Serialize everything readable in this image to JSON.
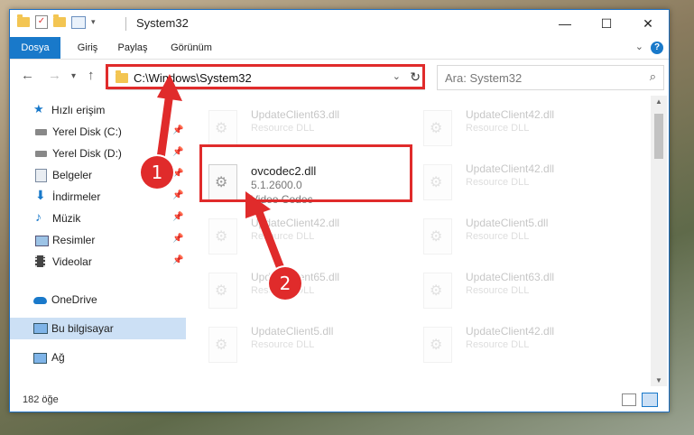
{
  "window": {
    "title": "System32",
    "minimize": "—",
    "maximize": "☐",
    "close": "✕"
  },
  "ribbon": {
    "tabs": [
      "Dosya",
      "Giriş",
      "Paylaş",
      "Görünüm"
    ],
    "help": "?",
    "expand": "⌄"
  },
  "nav": {
    "back": "←",
    "forward": "→",
    "recent": "▾",
    "up": "↑",
    "address": "C:\\Windows\\System32",
    "address_dropdown": "⌄",
    "refresh": "↻",
    "search_placeholder": "Ara: System32",
    "search_icon": "⌕"
  },
  "sidebar": {
    "items": [
      {
        "label": "Hızlı erişim",
        "icon": "star-icon",
        "pinned": false
      },
      {
        "label": "Yerel Disk (C:)",
        "icon": "drive-icon",
        "pinned": true
      },
      {
        "label": "Yerel Disk (D:)",
        "icon": "drive-icon",
        "pinned": true
      },
      {
        "label": "Belgeler",
        "icon": "documents-icon",
        "pinned": true
      },
      {
        "label": "İndirmeler",
        "icon": "downloads-icon",
        "pinned": true
      },
      {
        "label": "Müzik",
        "icon": "music-icon",
        "pinned": true
      },
      {
        "label": "Resimler",
        "icon": "pictures-icon",
        "pinned": true
      },
      {
        "label": "Videolar",
        "icon": "videos-icon",
        "pinned": true
      },
      {
        "label": "OneDrive",
        "icon": "onedrive-icon",
        "pinned": false
      },
      {
        "label": "Bu bilgisayar",
        "icon": "computer-icon",
        "pinned": false
      },
      {
        "label": "Ağ",
        "icon": "network-icon",
        "pinned": false
      }
    ],
    "pin_glyph": "📌"
  },
  "files": {
    "left": [
      {
        "name": "UpdateClient63.dll",
        "type": "Resource DLL"
      },
      {
        "name": "UpdateClient42.dll",
        "type": "Resource DLL"
      },
      {
        "name": "UpdateClient65.dll",
        "type": "Resource DLL"
      },
      {
        "name": "UpdateClient5.dll",
        "type": "Resource DLL"
      }
    ],
    "right": [
      {
        "name": "UpdateClient42.dll",
        "type": "Resource DLL"
      },
      {
        "name": "UpdateClient42.dll",
        "type": "Resource DLL"
      },
      {
        "name": "UpdateClient5.dll",
        "type": "Resource DLL"
      },
      {
        "name": "UpdateClient63.dll",
        "type": "Resource DLL"
      },
      {
        "name": "UpdateClient42.dll",
        "type": "Resource DLL"
      }
    ],
    "highlighted": {
      "name": "ovcodec2.dll",
      "version": "5.1.2600.0",
      "type": "Video Codec"
    }
  },
  "status": {
    "count": "182 öğe"
  },
  "annotations": {
    "step1": "1",
    "step2": "2",
    "color": "#e02b2b"
  }
}
